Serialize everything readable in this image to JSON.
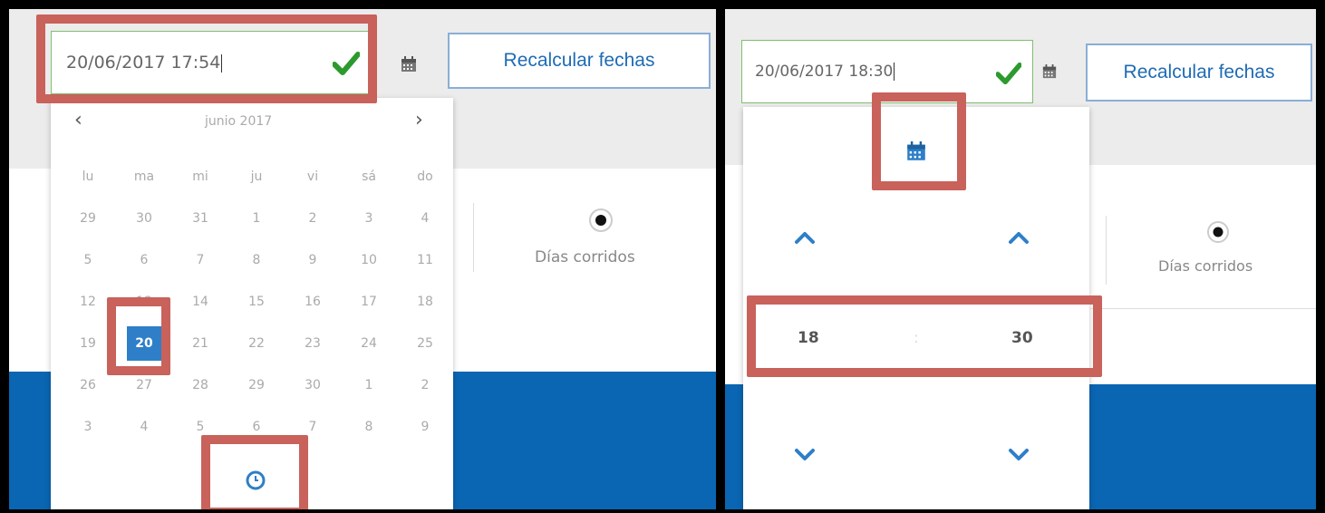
{
  "left": {
    "datetime_input": {
      "value": "20/06/2017 17:54"
    },
    "recalc_label": "Recalcular fechas",
    "calendar": {
      "month_label": "junio 2017",
      "prev": "‹",
      "next": "›",
      "weekdays": [
        "lu",
        "ma",
        "mi",
        "ju",
        "vi",
        "sá",
        "do"
      ],
      "weeks": [
        [
          "29",
          "30",
          "31",
          "1",
          "2",
          "3",
          "4"
        ],
        [
          "5",
          "6",
          "7",
          "8",
          "9",
          "10",
          "11"
        ],
        [
          "12",
          "13",
          "14",
          "15",
          "16",
          "17",
          "18"
        ],
        [
          "19",
          "20",
          "21",
          "22",
          "23",
          "24",
          "25"
        ],
        [
          "26",
          "27",
          "28",
          "29",
          "30",
          "1",
          "2"
        ],
        [
          "3",
          "4",
          "5",
          "6",
          "7",
          "8",
          "9"
        ]
      ],
      "selected_day": "20"
    },
    "radio_label": "Días corridos"
  },
  "right": {
    "datetime_input": {
      "value": "20/06/2017 18:30"
    },
    "recalc_label": "Recalcular fechas",
    "time": {
      "hours": "18",
      "minutes": "30",
      "separator": ":"
    },
    "radio_label": "Días corridos"
  },
  "colors": {
    "accent": "#2e7fc8",
    "highlight": "#c8625b",
    "check": "#2c9a2c",
    "brand_blue": "#0a65b2"
  }
}
